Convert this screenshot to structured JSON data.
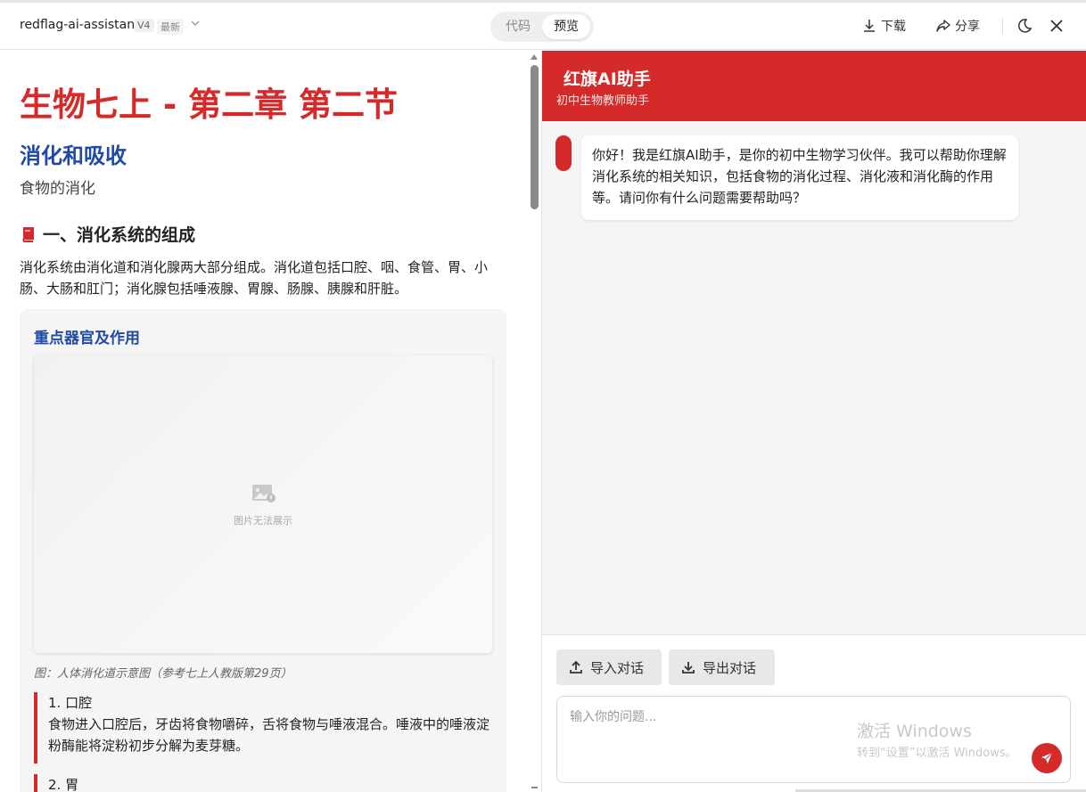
{
  "topbar": {
    "app_name": "redflag-ai-assistant",
    "version": "V4",
    "version_tag": "最新",
    "tabs": [
      "代码",
      "预览"
    ],
    "active_tab": "预览",
    "download_label": "下载",
    "share_label": "分享"
  },
  "doc": {
    "title": "生物七上 - 第二章 第二节",
    "subtitle": "消化和吸收",
    "intro": "食物的消化",
    "section_title": "一、消化系统的组成",
    "section_icon": "book-icon",
    "paragraph": "消化系统由消化道和消化腺两大部分组成。消化道包括口腔、咽、食管、胃、小肠、大肠和肛门；消化腺包括唾液腺、胃腺、肠腺、胰腺和肝脏。",
    "card": {
      "title": "重点器官及作用",
      "image_placeholder": "图片无法展示",
      "caption": "图：人体消化道示意图（参考七上人教版第29页）",
      "items": [
        {
          "title": "1. 口腔",
          "text": "食物进入口腔后，牙齿将食物嚼碎，舌将食物与唾液混合。唾液中的唾液淀粉酶能将淀粉初步分解为麦芽糖。"
        },
        {
          "title": "2. 胃",
          "text": ""
        }
      ]
    }
  },
  "chat": {
    "title": "红旗AI助手",
    "subtitle": "初中生物教师助手",
    "messages": [
      {
        "role": "assistant",
        "text": "你好！我是红旗AI助手，是你的初中生物学习伙伴。我可以帮助你理解消化系统的相关知识，包括食物的消化过程、消化液和消化酶的作用等。请问你有什么问题需要帮助吗？"
      }
    ],
    "import_label": "导入对话",
    "export_label": "导出对话",
    "input_placeholder": "输入你的问题...",
    "watermark_line1": "激活 Windows",
    "watermark_line2": "转到“设置”以激活 Windows。"
  },
  "colors": {
    "accent_red": "#d42a2a",
    "heading_blue": "#1f4aa8"
  }
}
